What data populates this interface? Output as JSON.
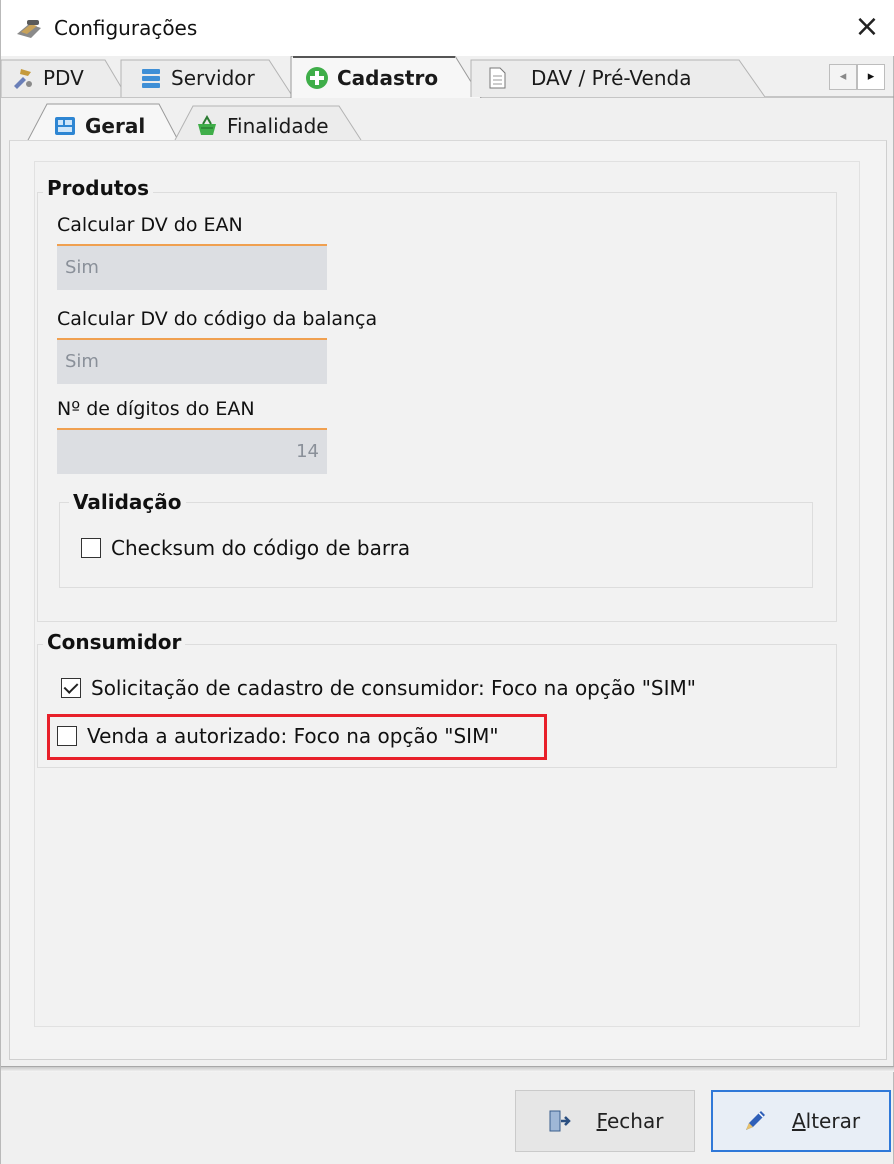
{
  "window": {
    "title": "Configurações",
    "close_glyph": "×"
  },
  "tabs": [
    {
      "label": "PDV",
      "icon": "tools-icon",
      "active": false
    },
    {
      "label": "Servidor",
      "icon": "database-icon",
      "active": false
    },
    {
      "label": "Cadastro",
      "icon": "plus-circle-icon",
      "active": true
    },
    {
      "label": "DAV / Pré-Venda",
      "icon": "document-icon",
      "active": false
    }
  ],
  "tab_scroll": {
    "left_glyph": "◂",
    "right_glyph": "▸"
  },
  "subtabs": [
    {
      "label": "Geral",
      "icon": "grid-icon",
      "active": true
    },
    {
      "label": "Finalidade",
      "icon": "basket-icon",
      "active": false
    }
  ],
  "produtos": {
    "title": "Produtos",
    "fields": [
      {
        "label": "Calcular DV do EAN",
        "value": "Sim"
      },
      {
        "label": "Calcular DV do código da balança",
        "value": "Sim"
      },
      {
        "label": "Nº de dígitos do EAN",
        "value": "14"
      }
    ],
    "validacao": {
      "title": "Validação",
      "checkbox": {
        "label": "Checksum do código de barra",
        "checked": false
      }
    }
  },
  "consumidor": {
    "title": "Consumidor",
    "checkboxes": [
      {
        "label": "Solicitação de cadastro de consumidor: Foco na opção \"SIM\"",
        "checked": true
      },
      {
        "label": "Venda a autorizado: Foco na opção \"SIM\"",
        "checked": false,
        "highlighted": true
      }
    ]
  },
  "buttons": {
    "fechar": {
      "first_letter": "F",
      "rest": "echar"
    },
    "alterar": {
      "first_letter": "A",
      "rest": "lterar"
    }
  },
  "colors": {
    "highlight": "#e8202a",
    "field_accent": "#f0a050",
    "primary_button_border": "#2f78d8"
  }
}
